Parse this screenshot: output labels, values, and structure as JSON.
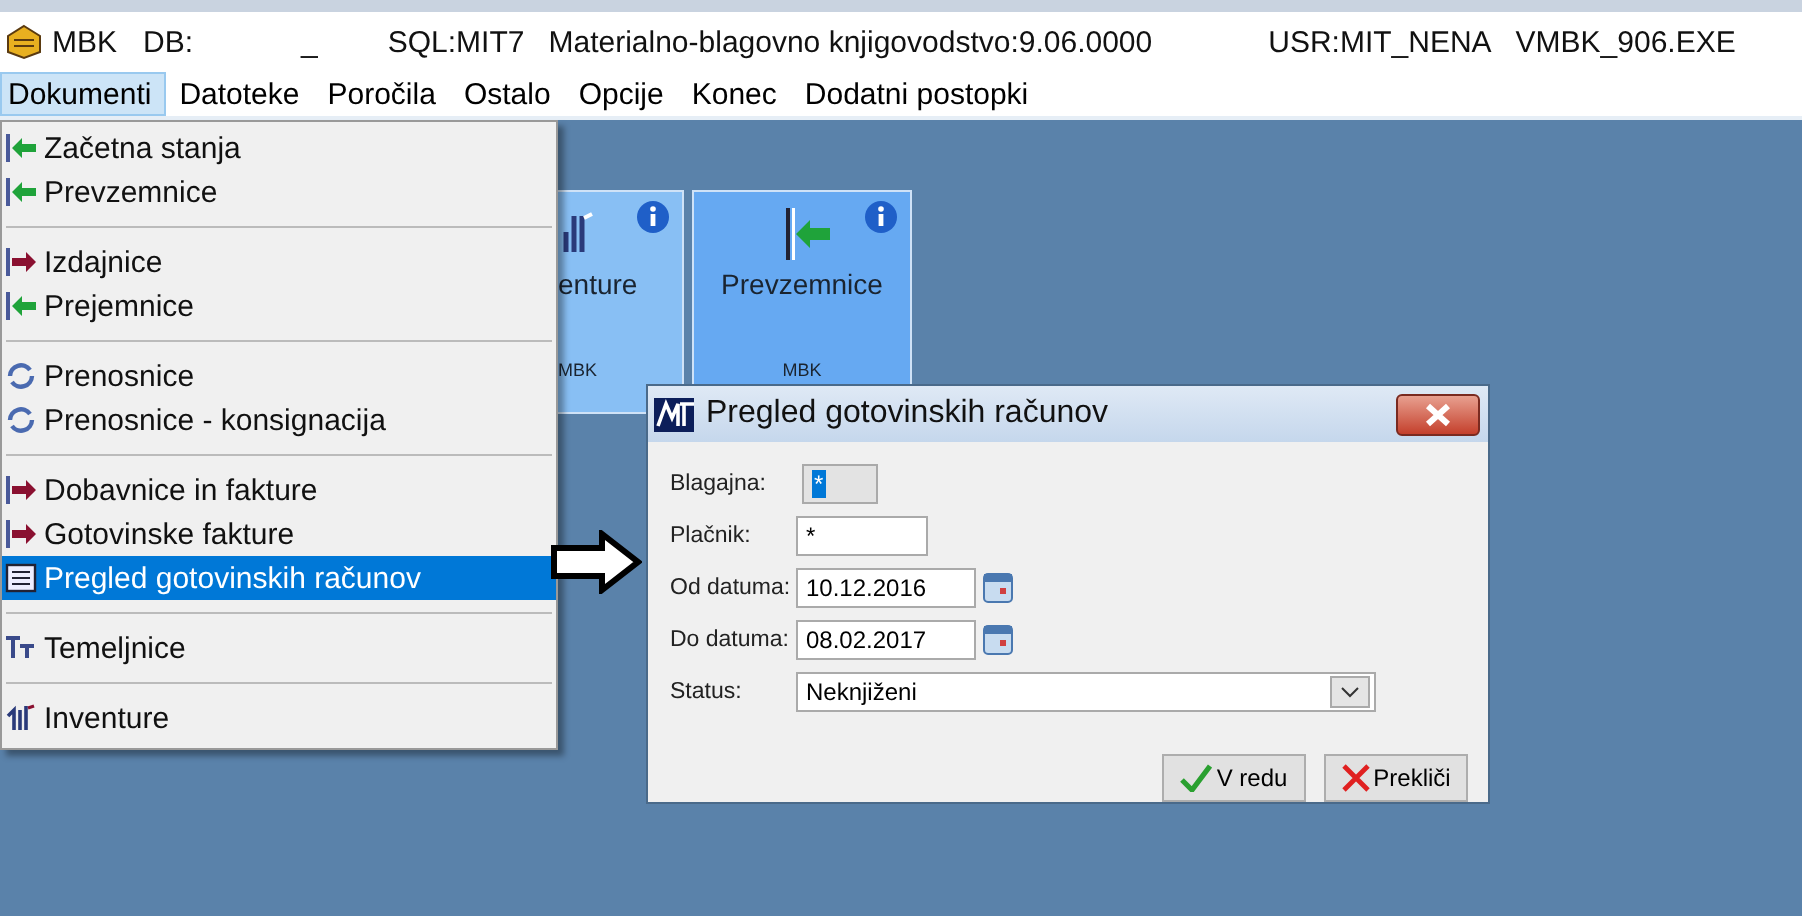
{
  "title_bar": {
    "app": "MBK",
    "db": "DB:",
    "db_value": "_",
    "sql": "SQL:MIT7",
    "product": "Materialno-blagovno knjigovodstvo:9.06.0000",
    "user": "USR:MIT_NENA",
    "exe": "VMBK_906.EXE"
  },
  "menu_bar": [
    {
      "label": "Dokumenti",
      "selected": true
    },
    {
      "label": "Datoteke",
      "selected": false
    },
    {
      "label": "Poročila",
      "selected": false
    },
    {
      "label": "Ostalo",
      "selected": false
    },
    {
      "label": "Opcije",
      "selected": false
    },
    {
      "label": "Konec",
      "selected": false
    },
    {
      "label": "Dodatni postopki",
      "selected": false
    }
  ],
  "dropdown": [
    [
      {
        "label": "Začetna stanja",
        "kind": "in",
        "selected": false
      },
      {
        "label": "Prevzemnice",
        "kind": "in",
        "selected": false
      }
    ],
    [
      {
        "label": "Izdajnice",
        "kind": "out",
        "selected": false
      },
      {
        "label": "Prejemnice",
        "kind": "in",
        "selected": false
      }
    ],
    [
      {
        "label": "Prenosnice",
        "kind": "cycle",
        "selected": false
      },
      {
        "label": "Prenosnice - konsignacija",
        "kind": "cycle",
        "selected": false
      }
    ],
    [
      {
        "label": "Dobavnice in fakture",
        "kind": "out",
        "selected": false
      },
      {
        "label": "Gotovinske fakture",
        "kind": "out",
        "selected": false
      },
      {
        "label": "Pregled gotovinskih računov",
        "kind": "list",
        "selected": true
      }
    ],
    [
      {
        "label": "Temeljnice",
        "kind": "text",
        "selected": false
      }
    ],
    [
      {
        "label": "Inventure",
        "kind": "inventory",
        "selected": false
      }
    ]
  ],
  "tiles": [
    {
      "label": "enture",
      "footer": "MBK",
      "kind": "inventory",
      "selected": false
    },
    {
      "label": "Prevzemnice",
      "footer": "MBK",
      "kind": "in",
      "selected": true
    }
  ],
  "dialog": {
    "title": "Pregled gotovinskih računov",
    "fields": [
      {
        "label": "Blagajna:",
        "value": "*",
        "kind": "readonly"
      },
      {
        "label": "Plačnik:",
        "value": "*",
        "kind": "short"
      },
      {
        "label": "Od datuma:",
        "value": "10.12.2016",
        "kind": "date"
      },
      {
        "label": "Do datuma:",
        "value": "08.02.2017",
        "kind": "date"
      },
      {
        "label": "Status:",
        "value": "Neknjiženi",
        "kind": "select"
      }
    ],
    "buttons": [
      {
        "label": "V redu",
        "kind": "ok"
      },
      {
        "label": "Prekliči",
        "kind": "cancel"
      }
    ]
  }
}
